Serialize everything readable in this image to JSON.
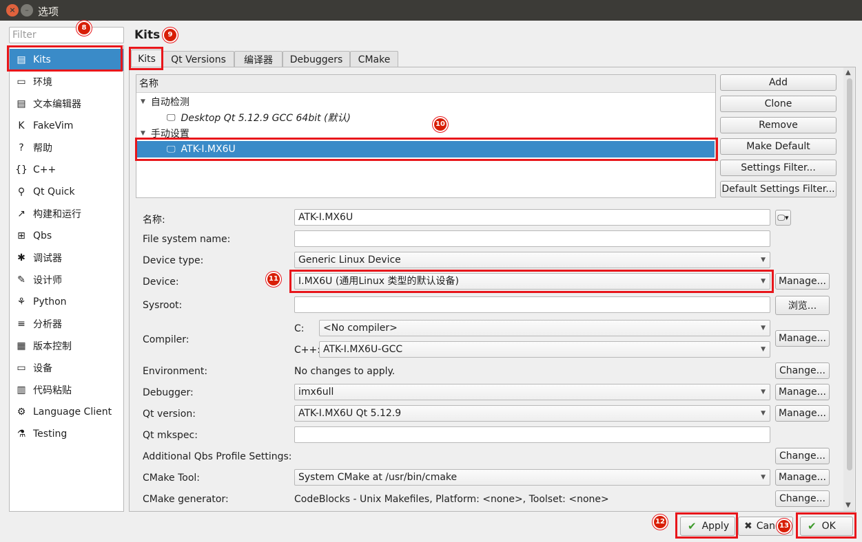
{
  "window": {
    "title": "选项"
  },
  "filter": {
    "placeholder": "Filter"
  },
  "sidebar": {
    "items": [
      {
        "label": "Kits",
        "icon": "kits-icon",
        "glyph": "▤"
      },
      {
        "label": "环境",
        "icon": "monitor-icon",
        "glyph": "▭"
      },
      {
        "label": "文本编辑器",
        "icon": "text-editor-icon",
        "glyph": "▤"
      },
      {
        "label": "FakeVim",
        "icon": "fakevim-icon",
        "glyph": "K"
      },
      {
        "label": "帮助",
        "icon": "help-icon",
        "glyph": "?"
      },
      {
        "label": "C++",
        "icon": "braces-icon",
        "glyph": "{}"
      },
      {
        "label": "Qt Quick",
        "icon": "qt-quick-icon",
        "glyph": "⚲"
      },
      {
        "label": "构建和运行",
        "icon": "hammer-icon",
        "glyph": "↗"
      },
      {
        "label": "Qbs",
        "icon": "qbs-icon",
        "glyph": "⊞"
      },
      {
        "label": "调试器",
        "icon": "bug-icon",
        "glyph": "✱"
      },
      {
        "label": "设计师",
        "icon": "pencil-icon",
        "glyph": "✎"
      },
      {
        "label": "Python",
        "icon": "python-icon",
        "glyph": "⚘"
      },
      {
        "label": "分析器",
        "icon": "analyzer-icon",
        "glyph": "≡"
      },
      {
        "label": "版本控制",
        "icon": "version-control-icon",
        "glyph": "▦"
      },
      {
        "label": "设备",
        "icon": "device-icon",
        "glyph": "▭"
      },
      {
        "label": "代码粘贴",
        "icon": "paste-icon",
        "glyph": "▥"
      },
      {
        "label": "Language Client",
        "icon": "language-client-icon",
        "glyph": "⚙"
      },
      {
        "label": "Testing",
        "icon": "flask-icon",
        "glyph": "⚗"
      }
    ]
  },
  "badges": [
    "8",
    "9",
    "10",
    "11",
    "12",
    "13"
  ],
  "page": {
    "title": "Kits",
    "tabs": [
      "Kits",
      "Qt Versions",
      "编译器",
      "Debuggers",
      "CMake"
    ]
  },
  "tree": {
    "header": "名称",
    "auto_group": "自动检测",
    "auto_kit": "Desktop Qt 5.12.9 GCC 64bit (默认)",
    "manual_group": "手动设置",
    "manual_kit": "ATK-I.MX6U"
  },
  "kit_buttons": [
    "Add",
    "Clone",
    "Remove",
    "Make Default",
    "Settings Filter...",
    "Default Settings Filter..."
  ],
  "form": {
    "name_label": "名称:",
    "name_value": "ATK-I.MX6U",
    "fs_label": "File system name:",
    "fs_value": "",
    "device_type_label": "Device type:",
    "device_type_value": "Generic Linux Device",
    "device_label": "Device:",
    "device_value": "I.MX6U (通用Linux 类型的默认设备)",
    "sysroot_label": "Sysroot:",
    "sysroot_value": "",
    "compiler_label": "Compiler:",
    "c_label": "C:",
    "c_value": "<No compiler>",
    "cpp_label": "C++:",
    "cpp_value": "ATK-I.MX6U-GCC",
    "env_label": "Environment:",
    "env_value": "No changes to apply.",
    "debugger_label": "Debugger:",
    "debugger_value": "imx6ull",
    "qt_label": "Qt version:",
    "qt_value": "ATK-I.MX6U Qt 5.12.9",
    "mkspec_label": "Qt mkspec:",
    "mkspec_value": "",
    "qbs_label": "Additional Qbs Profile Settings:",
    "cmake_tool_label": "CMake Tool:",
    "cmake_tool_value": "System CMake at /usr/bin/cmake",
    "cmake_gen_label": "CMake generator:",
    "cmake_gen_value": "CodeBlocks - Unix Makefiles, Platform: <none>, Toolset: <none>",
    "manage": "Manage...",
    "browse": "浏览...",
    "change": "Change..."
  },
  "dialog": {
    "apply": "Apply",
    "cancel": "Cancel",
    "ok": "OK"
  },
  "colors": {
    "accent": "#3a8bc8",
    "highlight": "#e8161b"
  }
}
